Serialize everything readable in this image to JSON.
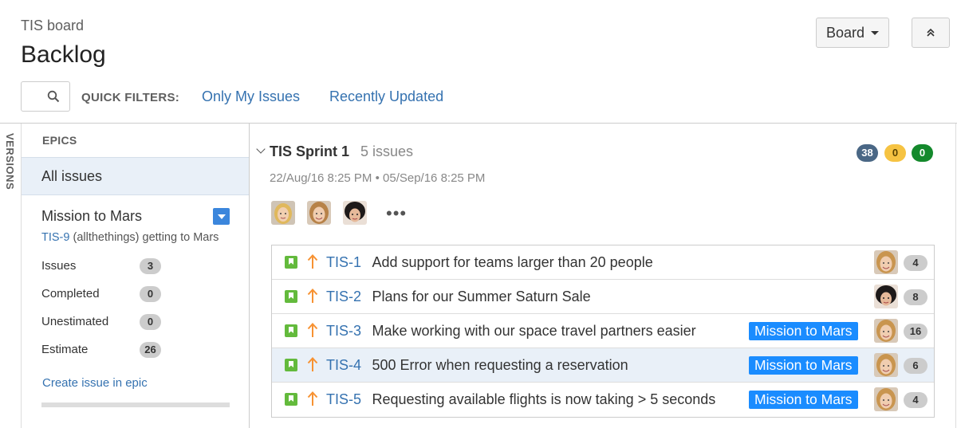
{
  "header": {
    "board_name": "TIS board",
    "page_title": "Backlog",
    "board_button": "Board"
  },
  "filters": {
    "label": "QUICK FILTERS:",
    "items": [
      "Only My Issues",
      "Recently Updated"
    ]
  },
  "versions_tab": "VERSIONS",
  "epics": {
    "title": "EPICS",
    "all_issues": "All issues",
    "epic": {
      "name": "Mission to Mars",
      "key": "TIS-9",
      "description": "(allthethings) getting to Mars",
      "stats": [
        {
          "label": "Issues",
          "value": "3"
        },
        {
          "label": "Completed",
          "value": "0"
        },
        {
          "label": "Unestimated",
          "value": "0"
        },
        {
          "label": "Estimate",
          "value": "26"
        }
      ],
      "create_link": "Create issue in epic",
      "progress": 0
    }
  },
  "sprint": {
    "name": "TIS Sprint 1",
    "issue_count": "5 issues",
    "dates": "22/Aug/16 8:25 PM • 05/Sep/16 8:25 PM",
    "status_counts": [
      {
        "value": "38",
        "color": "#4a6785",
        "text_color": "#ffffff"
      },
      {
        "value": "0",
        "color": "#f6c342",
        "text_color": "#594300"
      },
      {
        "value": "0",
        "color": "#14892c",
        "text_color": "#ffffff"
      }
    ],
    "more": "•••"
  },
  "issues": [
    {
      "key": "TIS-1",
      "summary": "Add support for teams larger than 20 people",
      "epic": "",
      "estimate": "4",
      "avatar": "blonde"
    },
    {
      "key": "TIS-2",
      "summary": "Plans for our Summer Saturn Sale",
      "epic": "",
      "estimate": "8",
      "avatar": "dark"
    },
    {
      "key": "TIS-3",
      "summary": "Make working with our space travel partners easier",
      "epic": "Mission to Mars",
      "estimate": "16",
      "avatar": "blonde"
    },
    {
      "key": "TIS-4",
      "summary": "500 Error when requesting a reservation",
      "epic": "Mission to Mars",
      "estimate": "6",
      "avatar": "blonde",
      "selected": true
    },
    {
      "key": "TIS-5",
      "summary": "Requesting available flights is now taking > 5 seconds",
      "epic": "Mission to Mars",
      "estimate": "4",
      "avatar": "blonde"
    }
  ],
  "icons": {
    "search": "search-icon",
    "collapse": "double-chevron-up-icon",
    "issue_type": "story-icon",
    "priority": "priority-high-arrow-icon"
  }
}
